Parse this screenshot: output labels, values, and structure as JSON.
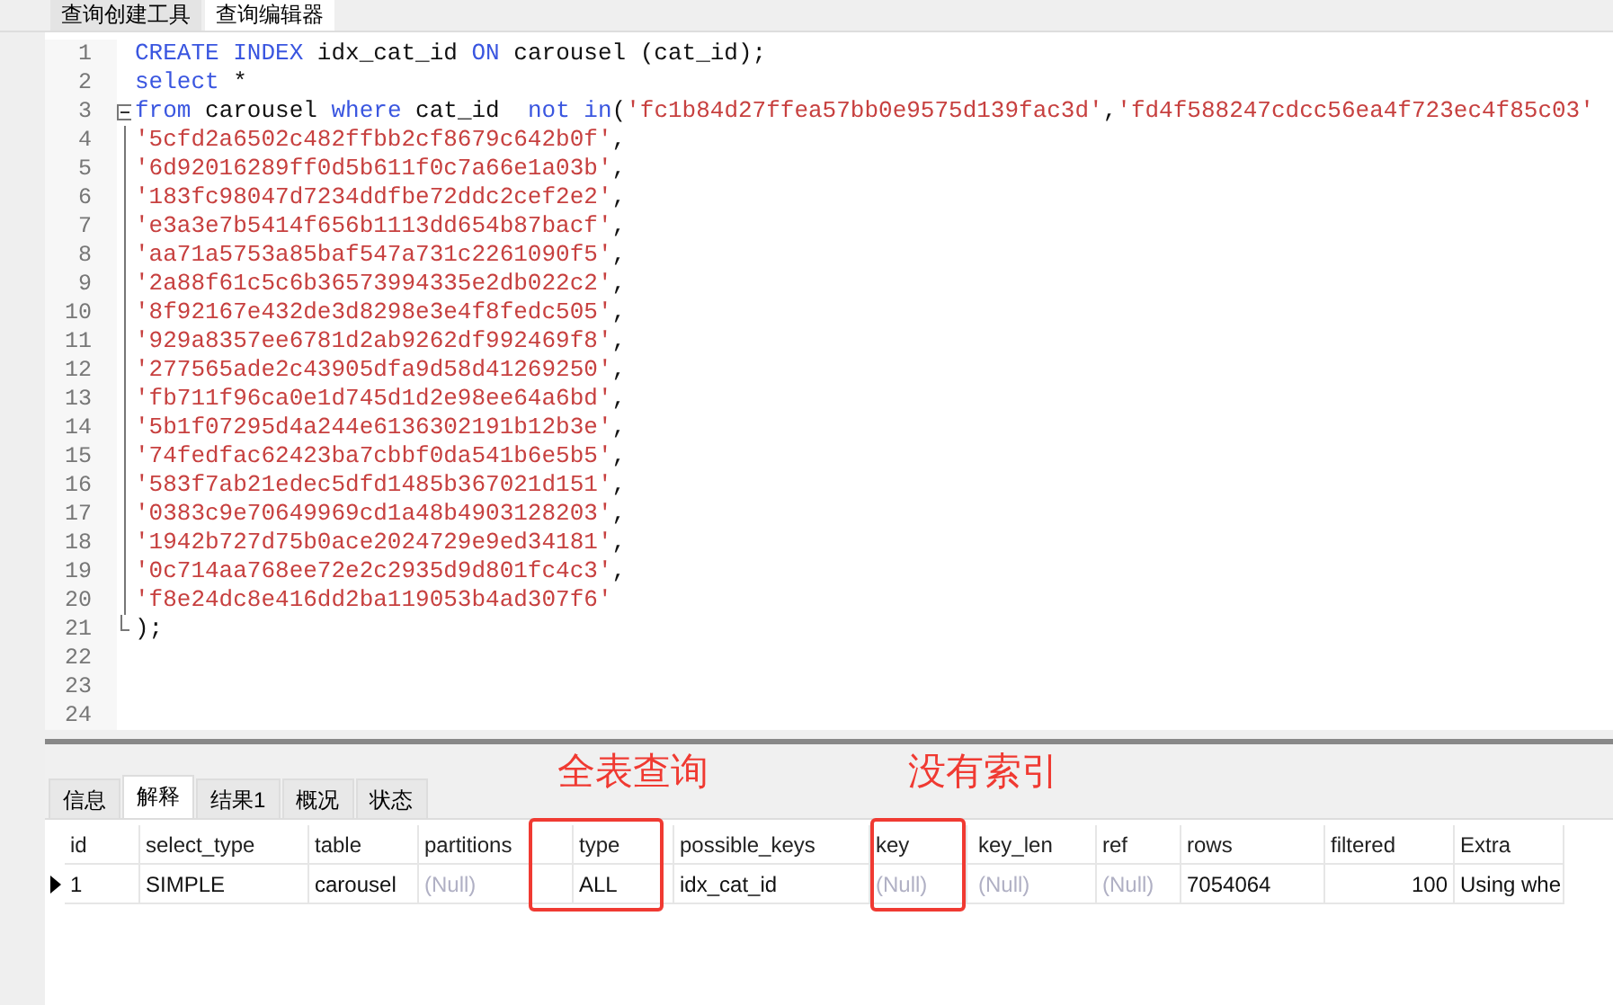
{
  "top_tabs": [
    {
      "label": "查询创建工具",
      "selected": false
    },
    {
      "label": "查询编辑器",
      "selected": true
    }
  ],
  "editor": {
    "lines": [
      {
        "number": "1",
        "tokens": [
          {
            "kind": "keyword",
            "text": "CREATE INDEX"
          },
          {
            "kind": "plain",
            "text": " idx_cat_id "
          },
          {
            "kind": "keyword",
            "text": "ON"
          },
          {
            "kind": "plain",
            "text": " carousel (cat_id);"
          }
        ]
      },
      {
        "number": "2",
        "tokens": [
          {
            "kind": "keyword",
            "text": "select"
          },
          {
            "kind": "plain",
            "text": " *"
          }
        ]
      },
      {
        "number": "3",
        "fold": true,
        "tokens": [
          {
            "kind": "keyword",
            "text": "from"
          },
          {
            "kind": "plain",
            "text": " carousel "
          },
          {
            "kind": "keyword",
            "text": "where"
          },
          {
            "kind": "plain",
            "text": " cat_id  "
          },
          {
            "kind": "keyword",
            "text": "not in"
          },
          {
            "kind": "plain",
            "text": "("
          },
          {
            "kind": "string",
            "text": "'fc1b84d27ffea57bb0e9575d139fac3d'"
          },
          {
            "kind": "plain",
            "text": ","
          },
          {
            "kind": "string",
            "text": "'fd4f588247cdcc56ea4f723ec4f85c03'"
          }
        ]
      },
      {
        "number": "4",
        "tokens": [
          {
            "kind": "string",
            "text": "'5cfd2a6502c482ffbb2cf8679c642b0f'"
          },
          {
            "kind": "plain",
            "text": ","
          }
        ]
      },
      {
        "number": "5",
        "tokens": [
          {
            "kind": "string",
            "text": "'6d92016289ff0d5b611f0c7a66e1a03b'"
          },
          {
            "kind": "plain",
            "text": ","
          }
        ]
      },
      {
        "number": "6",
        "tokens": [
          {
            "kind": "string",
            "text": "'183fc98047d7234ddfbe72ddc2cef2e2'"
          },
          {
            "kind": "plain",
            "text": ","
          }
        ]
      },
      {
        "number": "7",
        "tokens": [
          {
            "kind": "string",
            "text": "'e3a3e7b5414f656b1113dd654b87bacf'"
          },
          {
            "kind": "plain",
            "text": ","
          }
        ]
      },
      {
        "number": "8",
        "tokens": [
          {
            "kind": "string",
            "text": "'aa71a5753a85baf547a731c2261090f5'"
          },
          {
            "kind": "plain",
            "text": ","
          }
        ]
      },
      {
        "number": "9",
        "tokens": [
          {
            "kind": "string",
            "text": "'2a88f61c5c6b36573994335e2db022c2'"
          },
          {
            "kind": "plain",
            "text": ","
          }
        ]
      },
      {
        "number": "10",
        "tokens": [
          {
            "kind": "string",
            "text": "'8f92167e432de3d8298e3e4f8fedc505'"
          },
          {
            "kind": "plain",
            "text": ","
          }
        ]
      },
      {
        "number": "11",
        "tokens": [
          {
            "kind": "string",
            "text": "'929a8357ee6781d2ab9262df992469f8'"
          },
          {
            "kind": "plain",
            "text": ","
          }
        ]
      },
      {
        "number": "12",
        "tokens": [
          {
            "kind": "string",
            "text": "'277565ade2c43905dfa9d58d41269250'"
          },
          {
            "kind": "plain",
            "text": ","
          }
        ]
      },
      {
        "number": "13",
        "tokens": [
          {
            "kind": "string",
            "text": "'fb711f96ca0e1d745d1d2e98ee64a6bd'"
          },
          {
            "kind": "plain",
            "text": ","
          }
        ]
      },
      {
        "number": "14",
        "tokens": [
          {
            "kind": "string",
            "text": "'5b1f07295d4a244e6136302191b12b3e'"
          },
          {
            "kind": "plain",
            "text": ","
          }
        ]
      },
      {
        "number": "15",
        "tokens": [
          {
            "kind": "string",
            "text": "'74fedfac62423ba7cbbf0da541b6e5b5'"
          },
          {
            "kind": "plain",
            "text": ","
          }
        ]
      },
      {
        "number": "16",
        "tokens": [
          {
            "kind": "string",
            "text": "'583f7ab21edec5dfd1485b367021d151'"
          },
          {
            "kind": "plain",
            "text": ","
          }
        ]
      },
      {
        "number": "17",
        "tokens": [
          {
            "kind": "string",
            "text": "'0383c9e70649969cd1a48b4903128203'"
          },
          {
            "kind": "plain",
            "text": ","
          }
        ]
      },
      {
        "number": "18",
        "tokens": [
          {
            "kind": "string",
            "text": "'1942b727d75b0ace2024729e9ed34181'"
          },
          {
            "kind": "plain",
            "text": ","
          }
        ]
      },
      {
        "number": "19",
        "tokens": [
          {
            "kind": "string",
            "text": "'0c714aa768ee72e2c2935d9d801fc4c3'"
          },
          {
            "kind": "plain",
            "text": ","
          }
        ]
      },
      {
        "number": "20",
        "tokens": [
          {
            "kind": "string",
            "text": "'f8e24dc8e416dd2ba119053b4ad307f6'"
          }
        ]
      },
      {
        "number": "21",
        "fold_end": true,
        "tokens": [
          {
            "kind": "plain",
            "text": ");"
          }
        ]
      },
      {
        "number": "22"
      },
      {
        "number": "23"
      },
      {
        "number": "24"
      }
    ]
  },
  "result_tabs": [
    {
      "label": "信息",
      "selected": false
    },
    {
      "label": "解释",
      "selected": true
    },
    {
      "label": "结果1",
      "selected": false
    },
    {
      "label": "概况",
      "selected": false
    },
    {
      "label": "状态",
      "selected": false
    }
  ],
  "table": {
    "columns": [
      "id",
      "select_type",
      "table",
      "partitions",
      "type",
      "possible_keys",
      "key",
      "key_len",
      "ref",
      "rows",
      "filtered",
      "Extra"
    ],
    "rows": [
      {
        "current": true,
        "cells": [
          {
            "text": "1"
          },
          {
            "text": "SIMPLE"
          },
          {
            "text": "carousel"
          },
          {
            "text": "(Null)",
            "null": true
          },
          {
            "text": "ALL"
          },
          {
            "text": "idx_cat_id"
          },
          {
            "text": "(Null)",
            "null": true
          },
          {
            "text": "(Null)",
            "null": true
          },
          {
            "text": "(Null)",
            "null": true
          },
          {
            "text": "7054064"
          },
          {
            "text": "100"
          },
          {
            "text": "Using whe"
          }
        ]
      }
    ]
  },
  "annotations": [
    {
      "label": "全表查询"
    },
    {
      "label": "没有索引"
    }
  ]
}
